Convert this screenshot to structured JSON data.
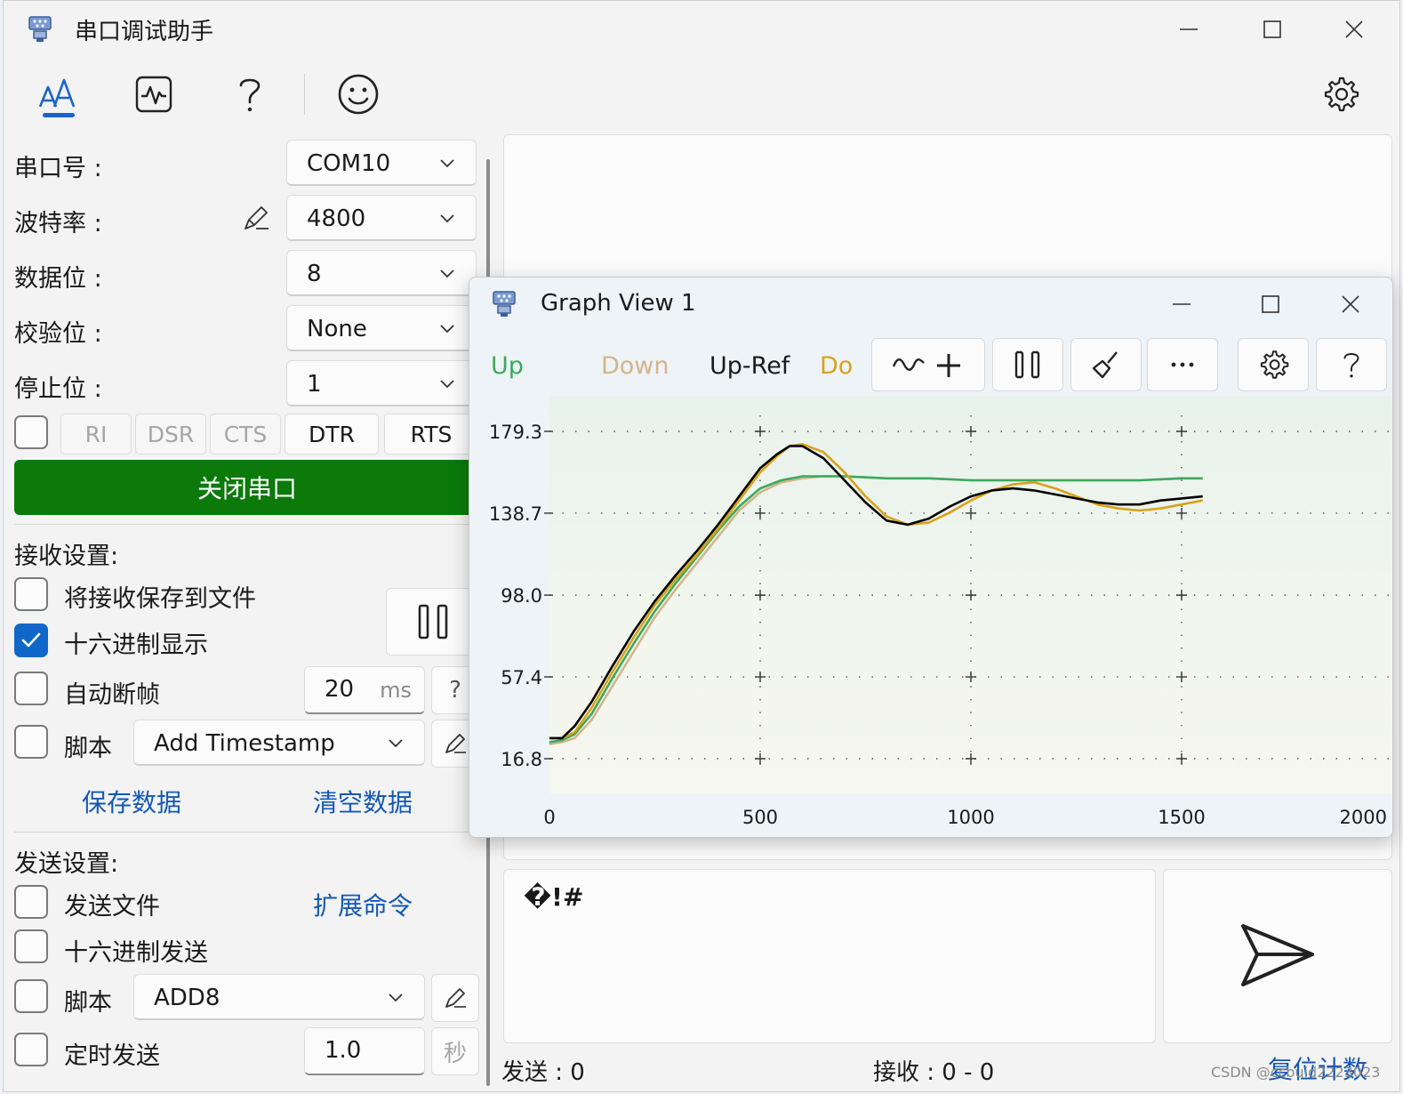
{
  "window": {
    "title": "串口调试助手",
    "minimize_icon": "minimize-icon",
    "maximize_icon": "maximize-icon",
    "close_icon": "close-icon"
  },
  "toolbar": {
    "items": [
      "font-text-icon",
      "waveform-icon",
      "help-icon",
      "smiley-icon"
    ],
    "settings_icon": "gear-icon"
  },
  "serial": {
    "port_label": "串口号 :",
    "port_value": "COM10",
    "baud_label": "波特率 :",
    "baud_value": "4800",
    "data_bits_label": "数据位 :",
    "data_bits_value": "8",
    "parity_label": "校验位 :",
    "parity_value": "None",
    "stop_bits_label": "停止位 :",
    "stop_bits_value": "1",
    "signals": [
      "RI",
      "DSR",
      "CTS",
      "DTR",
      "RTS"
    ],
    "toggle_button": "关闭串口",
    "toggle_color": "#0b7a0b"
  },
  "receive": {
    "section": "接收设置:",
    "save_to_file": "将接收保存到文件",
    "hex_display": "十六进制显示",
    "hex_display_checked": true,
    "auto_frame": "自动断帧",
    "auto_frame_value": "20",
    "auto_frame_unit": "ms",
    "auto_frame_help": "?",
    "script": "脚本",
    "script_value": "Add Timestamp",
    "save_data": "保存数据",
    "clear_data": "清空数据"
  },
  "send": {
    "section": "发送设置:",
    "send_file": "发送文件",
    "ext_command": "扩展命令",
    "hex_send": "十六进制发送",
    "script": "脚本",
    "script_value": "ADD8",
    "timed_send": "定时发送",
    "timed_value": "1.0",
    "timed_unit": "秒",
    "content": "�!#"
  },
  "status": {
    "sent": "发送 :  0",
    "received": "接收 :  0  -  0",
    "reset": "复位计数"
  },
  "graph": {
    "title": "Graph View 1",
    "legend": [
      {
        "name": "Up",
        "color": "#3aaa5c"
      },
      {
        "name": "Down",
        "color": "#d4b48a"
      },
      {
        "name": "Up-Ref",
        "color": "#1a1a1a"
      },
      {
        "name": "Do",
        "color": "#d9a21a"
      }
    ],
    "buttons": [
      "add-series-icon",
      "pause-icon",
      "brush-icon",
      "more-icon",
      "gear-icon",
      "help-icon"
    ]
  },
  "chart_data": {
    "type": "line",
    "xlim": [
      0,
      2000
    ],
    "ylim": [
      16.8,
      179.3
    ],
    "x_ticks": [
      "0",
      "500",
      "1000",
      "1500",
      "2000"
    ],
    "y_ticks": [
      "179.3",
      "138.7",
      "98.0",
      "57.4",
      "16.8"
    ],
    "grid": true,
    "series": [
      {
        "name": "Up-Ref",
        "color": "#000000",
        "x": [
          0,
          30,
          60,
          100,
          150,
          200,
          250,
          300,
          350,
          400,
          450,
          500,
          540,
          570,
          600,
          650,
          700,
          750,
          800,
          850,
          900,
          950,
          1000,
          1050,
          1100,
          1150,
          1200,
          1250,
          1300,
          1350,
          1400,
          1450,
          1500,
          1550
        ],
        "y": [
          27,
          27,
          33,
          45,
          63,
          80,
          95,
          108,
          120,
          133,
          147,
          161,
          168,
          172,
          172,
          166,
          155,
          144,
          135,
          133,
          136,
          142,
          147,
          150,
          151,
          150,
          148,
          146,
          144,
          143,
          143,
          145,
          146,
          147
        ]
      },
      {
        "name": "Do",
        "color": "#d9a21a",
        "x": [
          0,
          30,
          60,
          100,
          150,
          200,
          250,
          300,
          350,
          400,
          450,
          500,
          540,
          570,
          600,
          650,
          700,
          750,
          800,
          850,
          900,
          950,
          1000,
          1050,
          1100,
          1150,
          1200,
          1250,
          1300,
          1350,
          1400,
          1450,
          1500,
          1550
        ],
        "y": [
          27,
          27,
          30,
          42,
          60,
          77,
          93,
          106,
          118,
          131,
          145,
          159,
          167,
          172,
          173,
          169,
          159,
          147,
          137,
          133,
          134,
          139,
          145,
          150,
          153,
          154,
          151,
          147,
          143,
          141,
          140,
          141,
          143,
          145
        ]
      },
      {
        "name": "Up",
        "color": "#3aaa5c",
        "x": [
          0,
          30,
          60,
          100,
          150,
          200,
          250,
          300,
          350,
          400,
          450,
          500,
          550,
          600,
          650,
          700,
          800,
          900,
          1000,
          1100,
          1200,
          1300,
          1400,
          1500,
          1550
        ],
        "y": [
          25,
          26,
          29,
          39,
          57,
          74,
          90,
          104,
          117,
          130,
          142,
          151,
          155,
          157,
          157,
          157,
          156,
          156,
          155,
          155,
          155,
          155,
          155,
          156,
          156
        ]
      },
      {
        "name": "Down",
        "color": "#d4b48a",
        "x": [
          0,
          30,
          60,
          100,
          150,
          200,
          250,
          300,
          350,
          400,
          450,
          500,
          550,
          600,
          650,
          700,
          800,
          900,
          1000,
          1100,
          1200,
          1300,
          1400,
          1500,
          1550
        ],
        "y": [
          24,
          25,
          27,
          36,
          53,
          70,
          87,
          101,
          114,
          127,
          140,
          149,
          154,
          156,
          157,
          157,
          156,
          156,
          155,
          155,
          155,
          155,
          155,
          156,
          156
        ]
      }
    ]
  }
}
